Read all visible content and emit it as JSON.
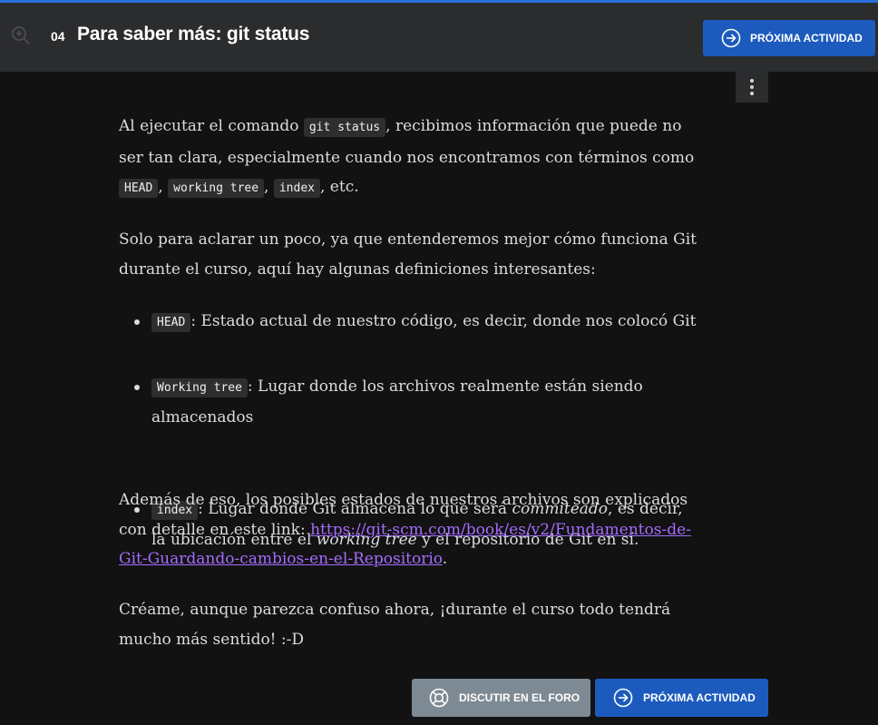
{
  "header": {
    "lesson_number": "04",
    "lesson_title": "Para saber más: git status",
    "next_button_label": "PRÓXIMA ACTIVIDAD"
  },
  "icons": {
    "zoom": "zoom-in-icon",
    "next": "arrow-right-circle-icon",
    "forum": "lifebuoy-icon",
    "menu": "kebab-menu-icon"
  },
  "content": {
    "p1": {
      "t1": "Al ejecutar el comando ",
      "c1": "git status",
      "t2": ", recibimos información que puede no ser tan clara, especialmente cuando nos encontramos con términos como ",
      "c2": "HEAD",
      "t3": ", ",
      "c3": "working tree",
      "t4": ", ",
      "c4": "index",
      "t5": ", etc."
    },
    "p2": "Solo para aclarar un poco, ya que entenderemos mejor cómo funciona Git durante el curso, aquí hay algunas definiciones interesantes:",
    "list": [
      {
        "code": "HEAD",
        "text": ": Estado actual de nuestro código, es decir, donde nos colocó Git"
      },
      {
        "code": "Working tree",
        "text": ": Lugar donde los archivos realmente están siendo almacenados"
      },
      {
        "code": "index",
        "t1": ": Lugar donde Git almacena lo que será ",
        "em1": "commiteado",
        "t2": ", es decir, la ubicación entre el ",
        "em2": "working tree",
        "t3": " y el repositorio de Git en sí."
      }
    ],
    "p3": {
      "t1": "Además de eso, los posibles estados de nuestros archivos son explicados con detalle en este link: ",
      "link": "https://git-scm.com/book/es/v2/Fundamentos-de-Git-Guardando-cambios-en-el-Repositorio",
      "t2": "."
    },
    "p4": "Créame, aunque parezca confuso ahora, ¡durante el curso todo tendrá mucho más sentido! :-D"
  },
  "footer": {
    "forum_button_label": "DISCUTIR EN EL FORO",
    "next_button_label": "PRÓXIMA ACTIVIDAD"
  },
  "colors": {
    "background": "#121212",
    "header": "#2b2c2e",
    "primary_button": "#1c5bbd",
    "secondary_button": "#7e8a93",
    "link": "#a66cff",
    "accent_line": "#2a6fdb"
  }
}
